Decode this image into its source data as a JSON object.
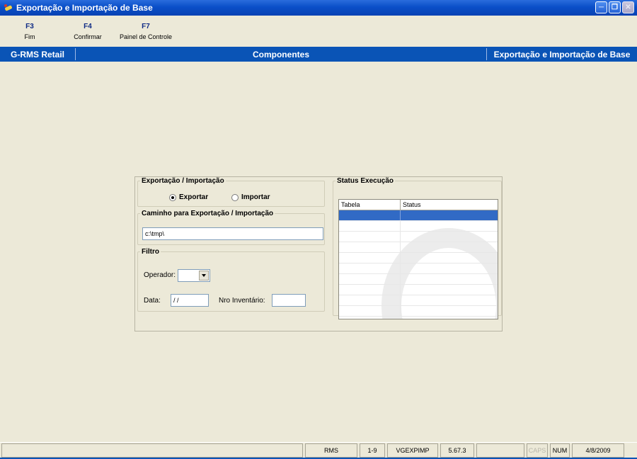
{
  "window": {
    "title": "Exportação e Importação de Base"
  },
  "function_keys": [
    {
      "key": "F3",
      "label": "Fim"
    },
    {
      "key": "F4",
      "label": "Confirmar"
    },
    {
      "key": "F7",
      "label": "Painel de Controle"
    }
  ],
  "header_band": {
    "left": "G-RMS Retail",
    "center": "Componentes",
    "right": "Exportação e Importação de Base"
  },
  "export_import": {
    "legend": "Exportação / Importação",
    "options": [
      {
        "label": "Exportar",
        "selected": true
      },
      {
        "label": "Importar",
        "selected": false
      }
    ]
  },
  "path_group": {
    "legend": "Caminho para Exportação / Importação",
    "value": "c:\\tmp\\"
  },
  "filter": {
    "legend": "Filtro",
    "operador_label": "Operador:",
    "operador_value": "",
    "data_label": "Data:",
    "data_value": "/ /",
    "inventario_label": "Nro Inventário:",
    "inventario_value": ""
  },
  "status_execucao": {
    "legend": "Status Execução",
    "columns": [
      "Tabela",
      "Status"
    ],
    "rows": []
  },
  "status_bar": {
    "system": "RMS",
    "range": "1-9",
    "program": "VGEXPIMP",
    "version": "5.67.3",
    "caps": "CAPS",
    "num": "NUM",
    "date": "4/8/2009"
  }
}
